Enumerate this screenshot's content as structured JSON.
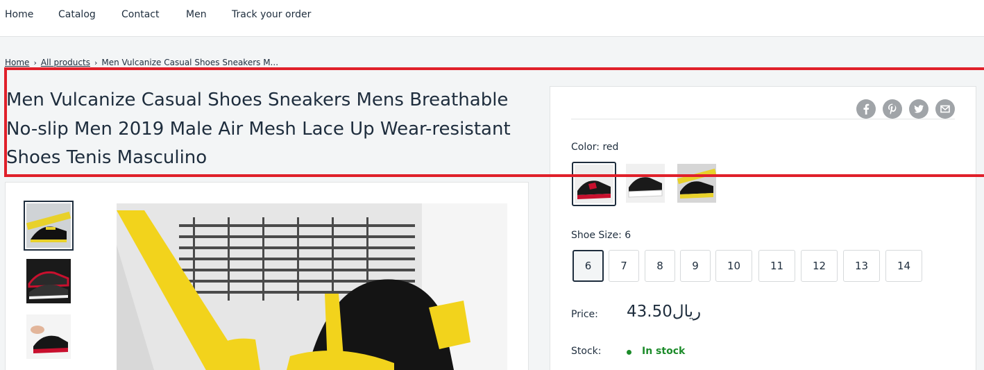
{
  "nav": {
    "items": [
      {
        "label": "Home"
      },
      {
        "label": "Catalog"
      },
      {
        "label": "Contact"
      },
      {
        "label": "Men"
      },
      {
        "label": "Track your order"
      }
    ]
  },
  "breadcrumb": {
    "home": "Home",
    "all_products": "All products",
    "current": "Men Vulcanize Casual Shoes Sneakers M...",
    "separator": "›"
  },
  "product": {
    "title": "Men Vulcanize Casual Shoes Sneakers Mens Breathable No-slip Men 2019 Male Air Mesh Lace Up Wear-resistant Shoes Tenis Masculino"
  },
  "share": {
    "icons": [
      "facebook-icon",
      "pinterest-icon",
      "twitter-icon",
      "email-icon"
    ]
  },
  "color_option": {
    "label": "Color:",
    "selected": "red"
  },
  "size_option": {
    "label": "Shoe Size:",
    "selected": "6",
    "sizes": [
      "6",
      "7",
      "8",
      "9",
      "10",
      "11",
      "12",
      "13",
      "14"
    ]
  },
  "price": {
    "label": "Price:",
    "value": "43.50ريال"
  },
  "stock": {
    "label": "Stock:",
    "value": "In stock"
  },
  "colors": {
    "accent": "#1e2d3d",
    "in_stock": "#1c8b2a",
    "highlight_box": "#e0202a"
  }
}
